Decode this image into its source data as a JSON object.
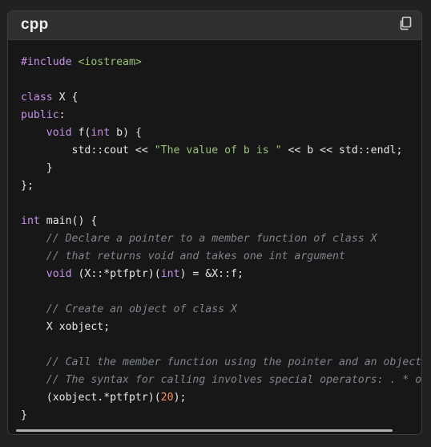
{
  "code_block": {
    "language": "cpp",
    "copy_icon": "copy-icon",
    "lines": [
      [
        {
          "t": "pre",
          "v": "#include "
        },
        {
          "t": "inc",
          "v": "<iostream>"
        }
      ],
      [],
      [
        {
          "t": "kw",
          "v": "class"
        },
        {
          "t": "plain",
          "v": " X {"
        }
      ],
      [
        {
          "t": "kw",
          "v": "public"
        },
        {
          "t": "plain",
          "v": ":"
        }
      ],
      [
        {
          "t": "plain",
          "v": "    "
        },
        {
          "t": "kw",
          "v": "void"
        },
        {
          "t": "plain",
          "v": " f("
        },
        {
          "t": "kw",
          "v": "int"
        },
        {
          "t": "plain",
          "v": " b) {"
        }
      ],
      [
        {
          "t": "plain",
          "v": "        std::cout << "
        },
        {
          "t": "str",
          "v": "\"The value of b is \""
        },
        {
          "t": "plain",
          "v": " << b << std::endl;"
        }
      ],
      [
        {
          "t": "plain",
          "v": "    }"
        }
      ],
      [
        {
          "t": "plain",
          "v": "};"
        }
      ],
      [],
      [
        {
          "t": "kw",
          "v": "int"
        },
        {
          "t": "plain",
          "v": " main() {"
        }
      ],
      [
        {
          "t": "plain",
          "v": "    "
        },
        {
          "t": "cmt",
          "v": "// Declare a pointer to a member function of class X"
        }
      ],
      [
        {
          "t": "plain",
          "v": "    "
        },
        {
          "t": "cmt",
          "v": "// that returns void and takes one int argument"
        }
      ],
      [
        {
          "t": "plain",
          "v": "    "
        },
        {
          "t": "kw",
          "v": "void"
        },
        {
          "t": "plain",
          "v": " (X::*ptfptr)("
        },
        {
          "t": "kw",
          "v": "int"
        },
        {
          "t": "plain",
          "v": ") = &X::f;"
        }
      ],
      [],
      [
        {
          "t": "plain",
          "v": "    "
        },
        {
          "t": "cmt",
          "v": "// Create an object of class X"
        }
      ],
      [
        {
          "t": "plain",
          "v": "    X xobject;"
        }
      ],
      [],
      [
        {
          "t": "plain",
          "v": "    "
        },
        {
          "t": "cmt",
          "v": "// Call the member function using the pointer and an object"
        }
      ],
      [
        {
          "t": "plain",
          "v": "    "
        },
        {
          "t": "cmt",
          "v": "// The syntax for calling involves special operators: . * or"
        }
      ],
      [
        {
          "t": "plain",
          "v": "    (xobject.*ptfptr)("
        },
        {
          "t": "num",
          "v": "20"
        },
        {
          "t": "plain",
          "v": ");"
        }
      ],
      [
        {
          "t": "plain",
          "v": "}"
        }
      ]
    ]
  },
  "colors": {
    "background": "#212121",
    "code_bg": "#171717",
    "keyword": "#c792ea",
    "string": "#98c379",
    "comment": "#7f848e",
    "number": "#f78c6c"
  }
}
